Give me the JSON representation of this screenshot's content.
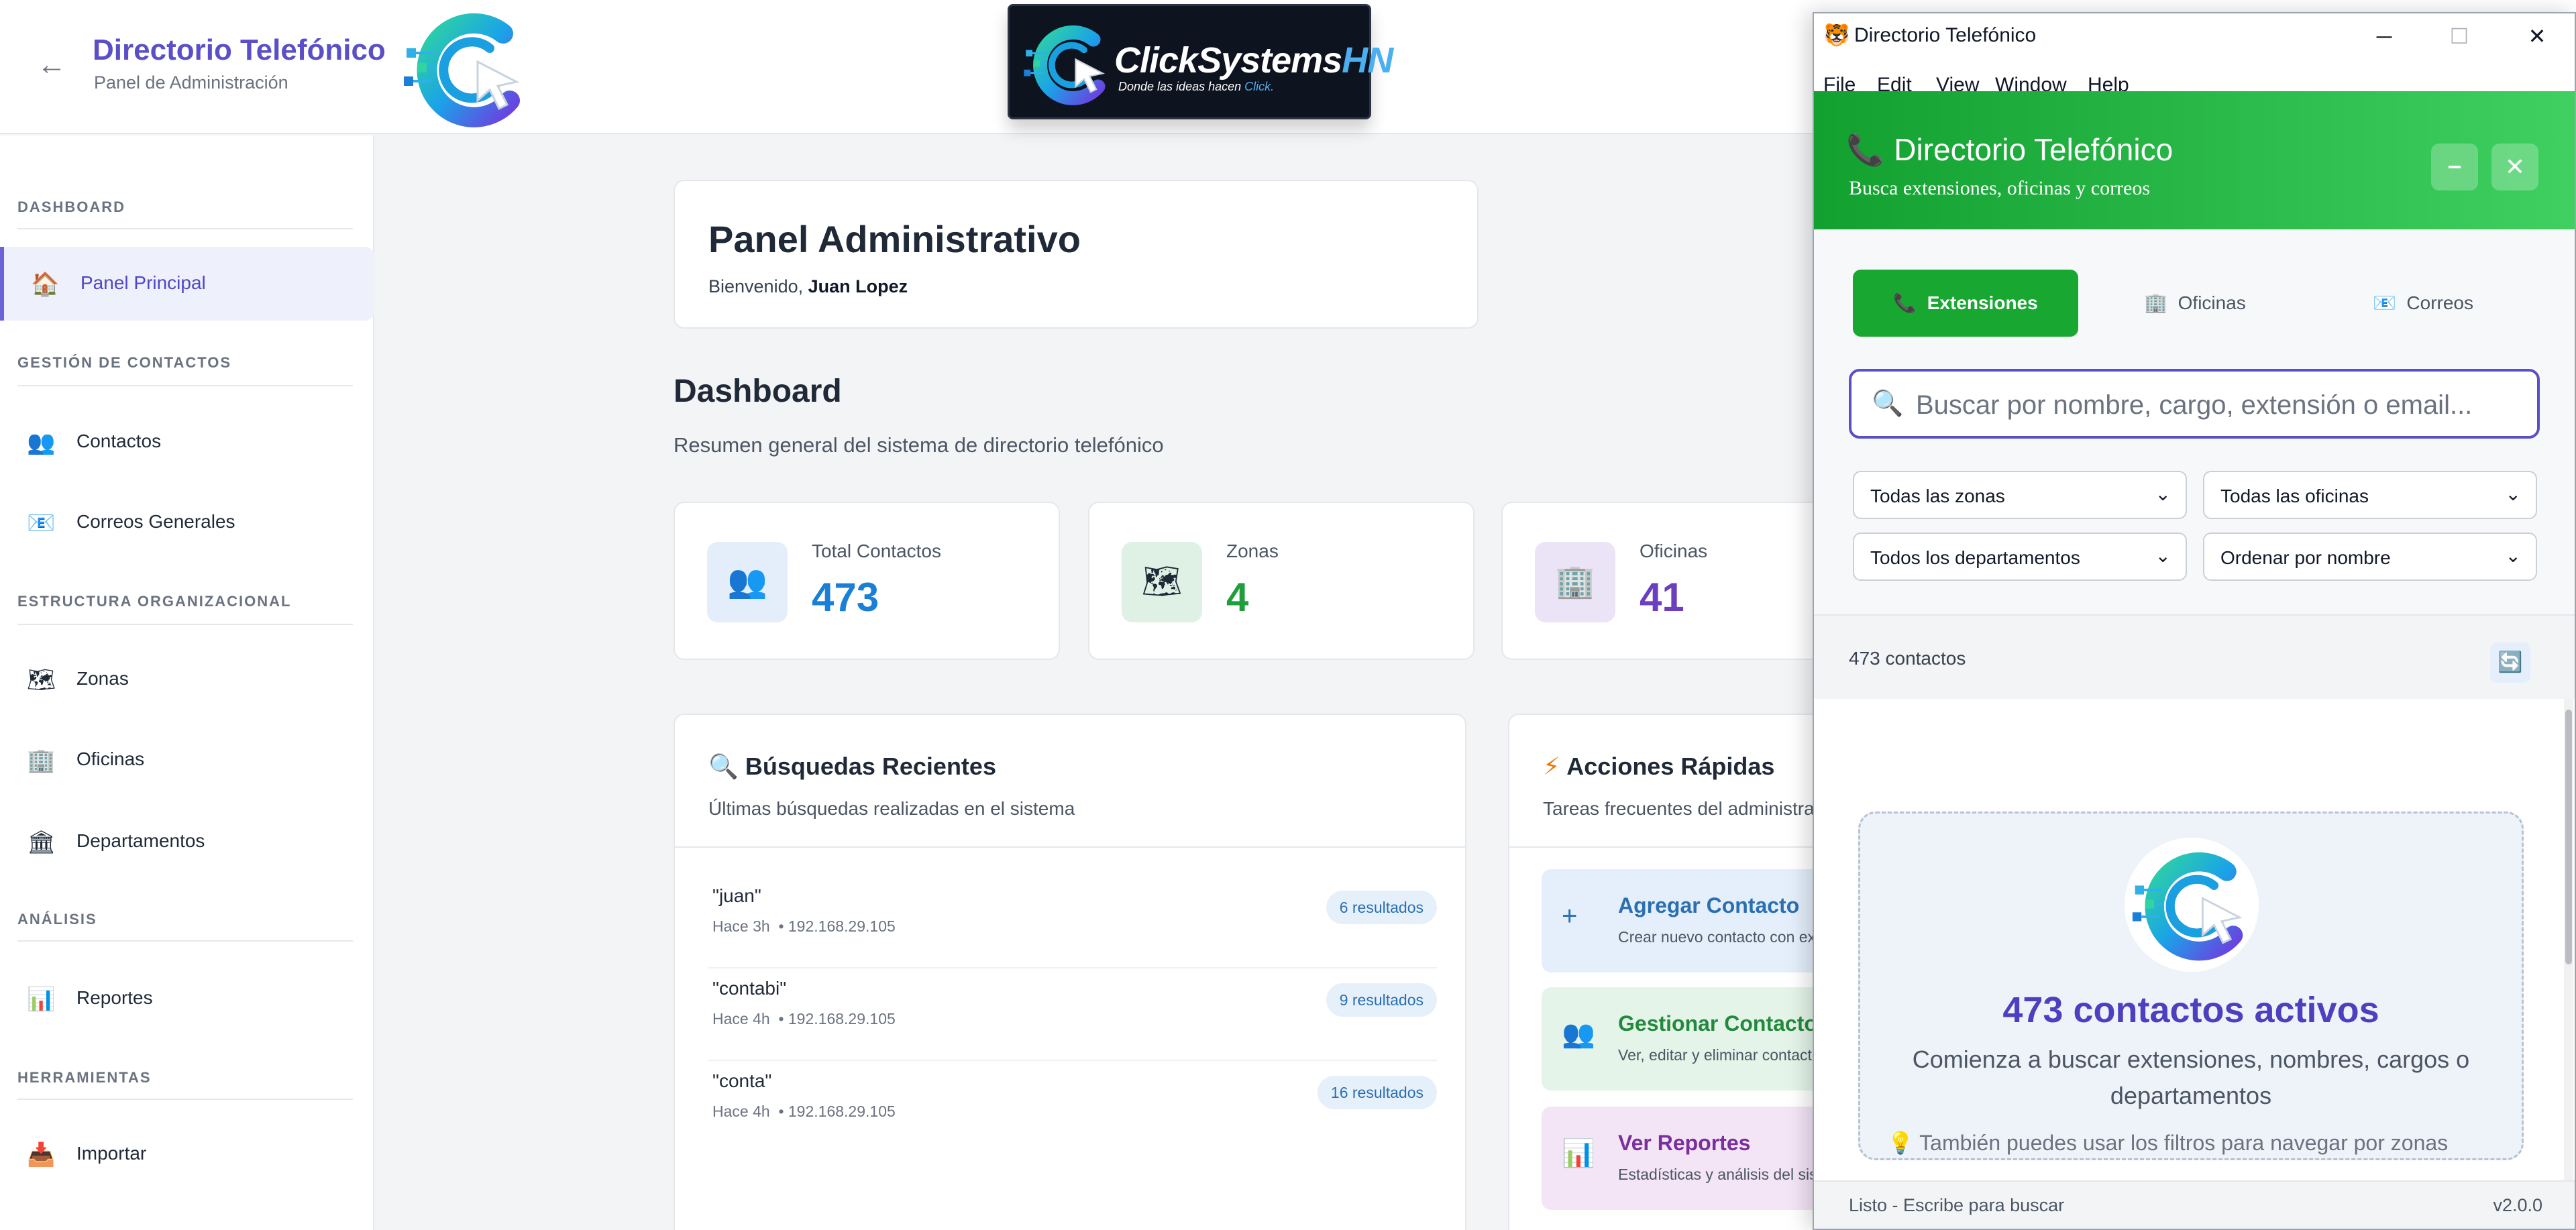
{
  "header": {
    "back_icon": "←",
    "title": "Directorio Telefónico",
    "subtitle": "Panel de Administración",
    "brand": {
      "name_main": "ClickSystems",
      "name_accent": "HN",
      "slogan_main": "Donde las ideas hacen ",
      "slogan_accent": "Click."
    }
  },
  "sidebar": {
    "sections": [
      {
        "title": "DASHBOARD",
        "items": [
          {
            "label": "Panel Principal",
            "icon": "home-icon",
            "glyph": "🏠",
            "active": true
          }
        ]
      },
      {
        "title": "GESTIÓN DE CONTACTOS",
        "items": [
          {
            "label": "Contactos",
            "icon": "users-icon",
            "glyph": "👥"
          },
          {
            "label": "Correos Generales",
            "icon": "email-icon",
            "glyph": "📧"
          }
        ]
      },
      {
        "title": "ESTRUCTURA ORGANIZACIONAL",
        "items": [
          {
            "label": "Zonas",
            "icon": "map-icon",
            "glyph": "🗺"
          },
          {
            "label": "Oficinas",
            "icon": "office-building-icon",
            "glyph": "🏢"
          },
          {
            "label": "Departamentos",
            "icon": "institution-icon",
            "glyph": "🏛"
          }
        ]
      },
      {
        "title": "ANÁLISIS",
        "items": [
          {
            "label": "Reportes",
            "icon": "bar-chart-icon",
            "glyph": "📊"
          }
        ]
      },
      {
        "title": "HERRAMIENTAS",
        "items": [
          {
            "label": "Importar",
            "icon": "import-icon",
            "glyph": "📥"
          }
        ]
      }
    ]
  },
  "main": {
    "welcome": {
      "title": "Panel Administrativo",
      "prefix": "Bienvenido, ",
      "user": "Juan Lopez"
    },
    "dashboard": {
      "title": "Dashboard",
      "subtitle": "Resumen general del sistema de directorio telefónico"
    },
    "stats": [
      {
        "label": "Total Contactos",
        "value": "473",
        "icon": "users-icon",
        "glyph": "👥",
        "color": "#1a7fd6",
        "bg": "#e3eefa"
      },
      {
        "label": "Zonas",
        "value": "4",
        "icon": "map-icon",
        "glyph": "🗺",
        "color": "#1f9e3c",
        "bg": "#dff1e4"
      },
      {
        "label": "Oficinas",
        "value": "41",
        "icon": "office-building-icon",
        "glyph": "🏢",
        "color": "#6b3fbf",
        "bg": "#ebe3f6"
      }
    ],
    "recent": {
      "icon": "search-icon",
      "glyph": "🔍",
      "title": "Búsquedas Recientes",
      "subtitle": "Últimas búsquedas realizadas en el sistema",
      "rows": [
        {
          "query": "\"juan\"",
          "time": "Hace 3h",
          "ip": "• 192.168.29.105",
          "results": "6 resultados"
        },
        {
          "query": "\"contabi\"",
          "time": "Hace 4h",
          "ip": "• 192.168.29.105",
          "results": "9 resultados"
        },
        {
          "query": "\"conta\"",
          "time": "Hace 4h",
          "ip": "• 192.168.29.105",
          "results": "16 resultados"
        }
      ]
    },
    "actions": {
      "icon": "lightning-icon",
      "glyph": "⚡",
      "title": "Acciones Rápidas",
      "subtitle": "Tareas frecuentes del administrador",
      "items": [
        {
          "title": "Agregar Contacto",
          "desc": "Crear nuevo contacto con extensión",
          "icon": "plus-icon",
          "glyph": "+",
          "color": "#2a6fb0",
          "bg": "#e4effb"
        },
        {
          "title": "Gestionar Contactos",
          "desc": "Ver, editar y eliminar contactos",
          "icon": "users-icon",
          "glyph": "👥",
          "color": "#238a3d",
          "bg": "#e4f4e8"
        },
        {
          "title": "Ver Reportes",
          "desc": "Estadísticas y análisis del sistema",
          "icon": "bar-chart-icon",
          "glyph": "📊",
          "color": "#7a2f9c",
          "bg": "#f3e4f6"
        }
      ]
    }
  },
  "window": {
    "title": "Directorio Telefónico",
    "app_icon": "🐯",
    "controls": {
      "minimize": "─",
      "maximize": "☐",
      "close": "✕"
    },
    "menu": [
      "File",
      "Edit",
      "View",
      "Window",
      "Help"
    ],
    "header": {
      "glyph": "📞",
      "title": "Directorio Telefónico",
      "subtitle": "Busca extensiones, oficinas y correos",
      "min_btn": "−",
      "close_btn": "✕"
    },
    "tabs": [
      {
        "label": "Extensiones",
        "icon": "phone-icon",
        "glyph": "📞",
        "active": true
      },
      {
        "label": "Oficinas",
        "icon": "office-building-icon",
        "glyph": "🏢"
      },
      {
        "label": "Correos",
        "icon": "email-icon",
        "glyph": "📧"
      }
    ],
    "search": {
      "glyph": "🔍",
      "placeholder": "Buscar por nombre, cargo, extensión o email...",
      "value": ""
    },
    "filters": [
      "Todas las zonas",
      "Todas las oficinas",
      "Todos los departamentos",
      "Ordenar por nombre"
    ],
    "filter_chevron": "⌄",
    "count": "473 contactos",
    "refresh_glyph": "🔄",
    "empty": {
      "title": "473 contactos activos",
      "text": "Comienza a buscar extensiones, nombres, cargos o departamentos",
      "tip": "💡 También puedes usar los filtros para navegar por zonas"
    },
    "status": "Listo - Escribe para buscar",
    "version": "v2.0.0"
  }
}
